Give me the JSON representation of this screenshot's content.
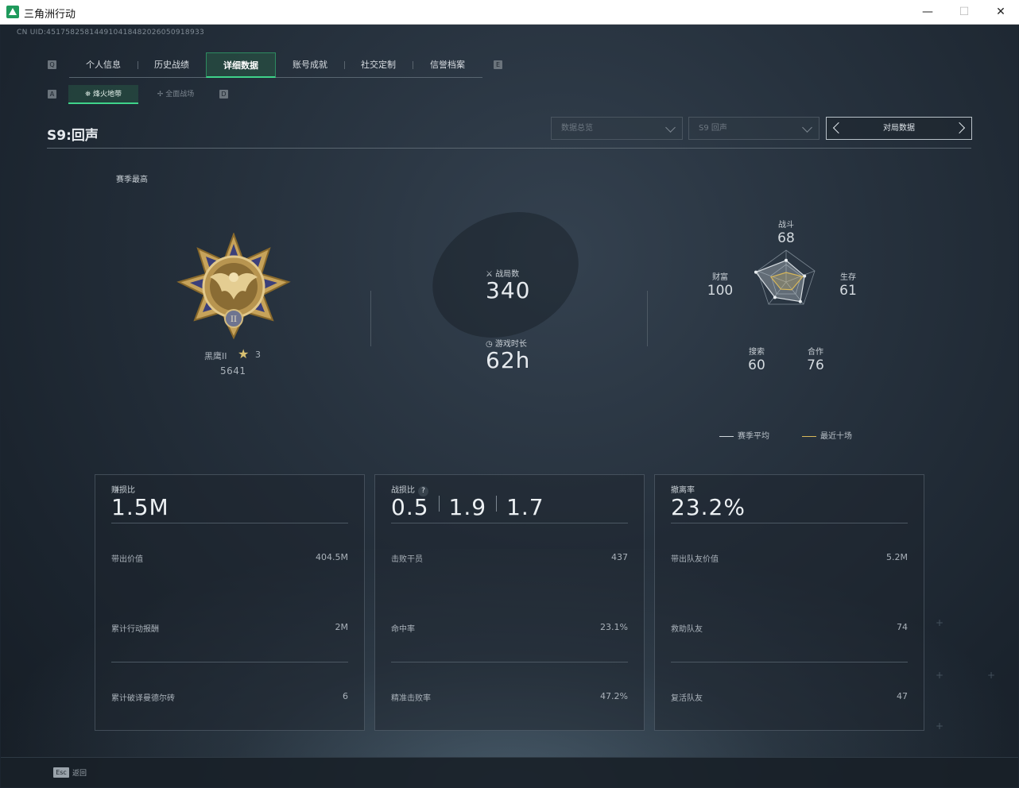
{
  "window": {
    "title": "三角洲行动",
    "controls": {
      "minimize": "—",
      "maximize": "☐",
      "close": "✕"
    }
  },
  "uid": "CN UID:451758258144910418482026050918933",
  "hints": {
    "tab_prev": "Q",
    "tab_next": "E",
    "sub_prev": "A",
    "sub_next": "D"
  },
  "tabs": [
    {
      "label": "个人信息",
      "active": false
    },
    {
      "label": "历史战绩",
      "active": false
    },
    {
      "label": "详细数据",
      "active": true
    },
    {
      "label": "账号成就",
      "active": false
    },
    {
      "label": "社交定制",
      "active": false
    },
    {
      "label": "信誉档案",
      "active": false
    }
  ],
  "subtabs": {
    "active": "烽火地带",
    "inactive": "全面战场"
  },
  "season": "S9:回声",
  "filters": {
    "scope": "数据总览",
    "season": "S9 回声",
    "match_button": "对局数据"
  },
  "section_label": "赛季最高",
  "rank": {
    "name": "黑鹰II",
    "stars": "3",
    "score": "5641",
    "numeral": "II"
  },
  "stats": {
    "matches_label": "战局数",
    "matches": "340",
    "playtime_label": "游戏时长",
    "playtime": "62h"
  },
  "radar": {
    "combat": {
      "label": "战斗",
      "value": "68"
    },
    "survival": {
      "label": "生存",
      "value": "61"
    },
    "cooperation": {
      "label": "合作",
      "value": "76"
    },
    "search": {
      "label": "搜索",
      "value": "60"
    },
    "wealth": {
      "label": "财富",
      "value": "100"
    },
    "legend_season": "赛季平均",
    "legend_recent": "最近十场",
    "colors": {
      "season": "#cfd6dc",
      "recent": "#d8b85a"
    }
  },
  "cards": {
    "profit": {
      "title": "赚损比",
      "big": "1.5M",
      "rows": [
        {
          "label": "带出价值",
          "value": "404.5M"
        },
        {
          "label": "累计行动报酬",
          "value": "2M"
        },
        {
          "label": "累计破译曼德尔砖",
          "value": "6"
        }
      ]
    },
    "kd": {
      "title": "战损比",
      "help": "?",
      "values": [
        "0.5",
        "1.9",
        "1.7"
      ],
      "rows": [
        {
          "label": "击败干员",
          "value": "437"
        },
        {
          "label": "命中率",
          "value": "23.1%"
        },
        {
          "label": "精准击败率",
          "value": "47.2%"
        }
      ]
    },
    "extract": {
      "title": "撤离率",
      "big": "23.2%",
      "rows": [
        {
          "label": "带出队友价值",
          "value": "5.2M"
        },
        {
          "label": "救助队友",
          "value": "74"
        },
        {
          "label": "复活队友",
          "value": "47"
        }
      ]
    }
  },
  "footer": {
    "key": "Esc",
    "label": "返回"
  }
}
